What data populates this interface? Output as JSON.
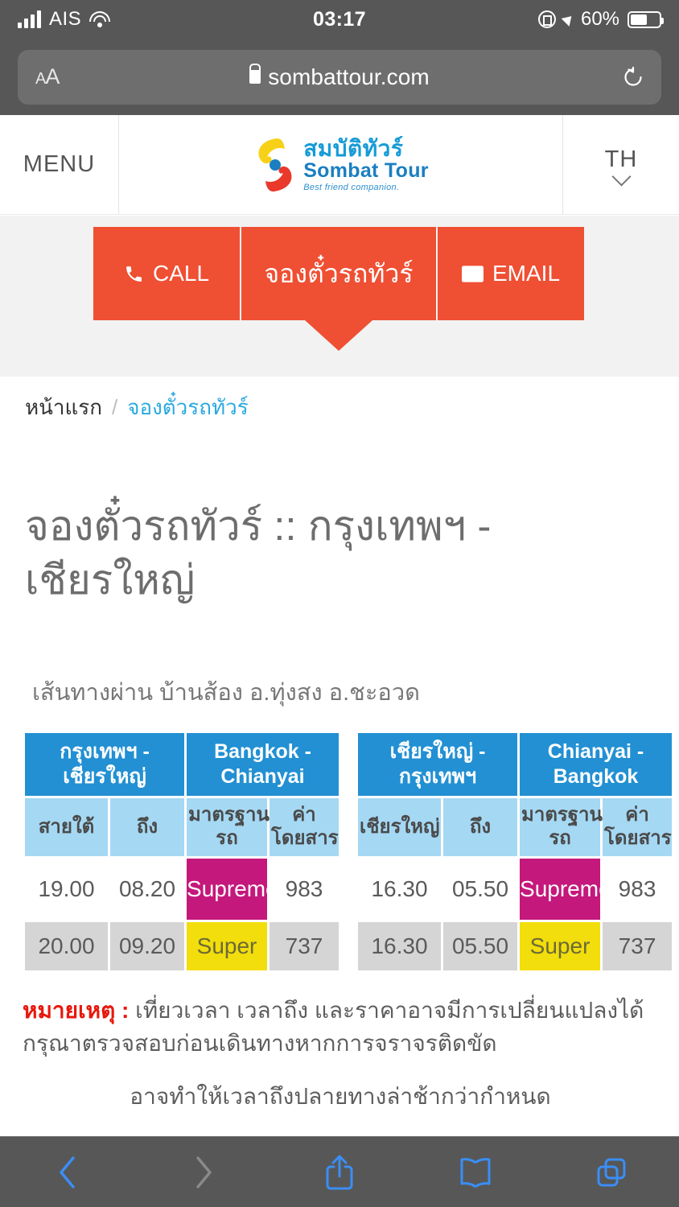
{
  "status_bar": {
    "carrier": "AIS",
    "time": "03:17",
    "battery_percent": "60%",
    "icons": [
      "signal-bars-icon",
      "wifi-icon",
      "rotation-lock-icon",
      "location-arrow-icon",
      "battery-icon"
    ]
  },
  "browser": {
    "text_size_label": "AA",
    "url": "sombattour.com",
    "lock_icon": "lock-icon",
    "reload_icon": "reload-icon",
    "toolbar": {
      "back": "back-chevron-icon",
      "forward": "forward-chevron-icon",
      "share": "share-icon",
      "bookmarks": "book-icon",
      "tabs": "tabs-icon"
    }
  },
  "site_header": {
    "menu_label": "MENU",
    "logo": {
      "thai": "สมบัติทัวร์",
      "english": "Sombat Tour",
      "tagline": "Best friend companion."
    },
    "language": "TH"
  },
  "action_buttons": [
    {
      "label": "CALL",
      "icon": "phone-icon"
    },
    {
      "label": "จองตั๋วรถทัวร์",
      "icon": ""
    },
    {
      "label": "EMAIL",
      "icon": "envelope-icon"
    }
  ],
  "breadcrumb": {
    "home": "หน้าแรก",
    "separator": "/",
    "current": "จองตั๋วรถทัวร์"
  },
  "page": {
    "title": "จองตั๋วรถทัวร์ :: กรุงเทพฯ - เชียรใหญ่",
    "subtitle": "เส้นทางผ่าน บ้านส้อง อ.ทุ่งสง อ.ชะอวด"
  },
  "tables": [
    {
      "header_thai": "กรุงเทพฯ - เชียรใหญ่",
      "header_english": "Bangkok - Chianyai",
      "columns": [
        "สายใต้",
        "ถึง",
        "มาตรฐานรถ",
        "ค่าโดยสาร"
      ],
      "rows": [
        {
          "depart": "19.00",
          "arrive": "08.20",
          "class": "Supreme",
          "fare": "983"
        },
        {
          "depart": "20.00",
          "arrive": "09.20",
          "class": "Super",
          "fare": "737"
        }
      ]
    },
    {
      "header_thai": "เชียรใหญ่  - กรุงเทพฯ",
      "header_english": "Chianyai - Bangkok",
      "columns": [
        "เชียรใหญ่",
        "ถึง",
        "มาตรฐานรถ",
        "ค่าโดยสาร"
      ],
      "rows": [
        {
          "depart": "16.30",
          "arrive": "05.50",
          "class": "Supreme",
          "fare": "983"
        },
        {
          "depart": "16.30",
          "arrive": "05.50",
          "class": "Super",
          "fare": "737"
        }
      ]
    }
  ],
  "note": {
    "label": "หมายเหตุ :",
    "line1": "เที่ยวเวลา เวลาถึง และราคาอาจมีการเปลี่ยนแปลงได้",
    "line2": "กรุณาตรวจสอบก่อนเดินทางหากการจราจรติดขัด",
    "line3": "อาจทำให้เวลาถึงปลายทางล่าช้ากว่ากำหนด"
  },
  "colors": {
    "accent_orange": "#ef4f33",
    "header_blue": "#2290d3",
    "subheader_blue": "#a5d8f3",
    "supreme_magenta": "#c4187c",
    "super_yellow": "#f2dd0d",
    "link_blue": "#2aa9e0",
    "note_red": "#e8170c",
    "chrome_gray": "#575757"
  }
}
